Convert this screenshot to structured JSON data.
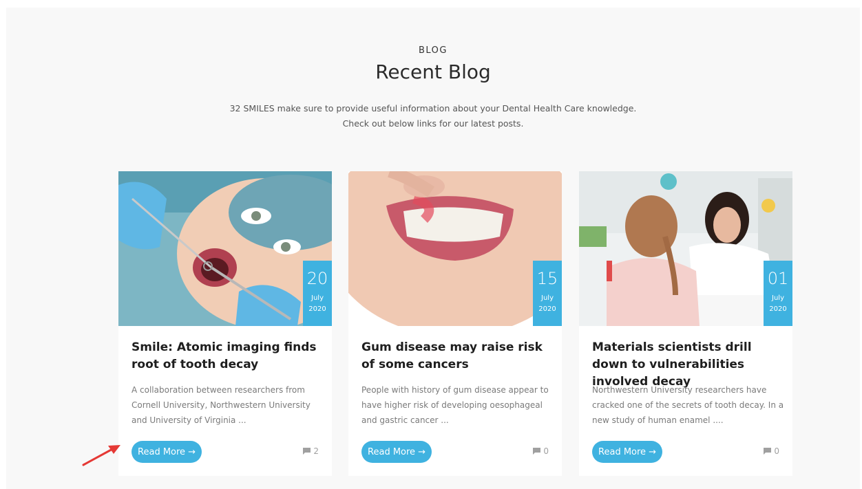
{
  "section": {
    "eyebrow": "BLOG",
    "title": "Recent Blog",
    "description_line1": "32 SMILES make sure to provide useful information about your Dental Health Care knowledge.",
    "description_line2": "Check out below links for our latest posts."
  },
  "posts": [
    {
      "day": "20",
      "month": "July",
      "year": "2020",
      "title": "Smile: Atomic imaging finds root of tooth decay",
      "excerpt": "A collaboration between researchers from Cornell University, Northwestern University and University of Virginia ...",
      "button_label": "Read More",
      "comments": "2"
    },
    {
      "day": "15",
      "month": "July",
      "year": "2020",
      "title": "Gum disease may raise risk of some cancers",
      "excerpt": "People with history of gum disease appear to have higher risk of developing oesophageal and gastric cancer ...",
      "button_label": "Read More",
      "comments": "0"
    },
    {
      "day": "01",
      "month": "July",
      "year": "2020",
      "title": "Materials scientists drill down to vulnerabilities involved decay",
      "excerpt": "Northwestern University researchers have cracked one of the secrets of tooth decay. In a new study of human enamel ....",
      "button_label": "Read More",
      "comments": "0"
    }
  ],
  "icons": {
    "button_arrow": "arrow-right-icon",
    "comment": "comment-icon",
    "cursor": "mouse-cursor-icon",
    "annotation": "red-arrow-annotation"
  },
  "colors": {
    "accent": "#3fb2e0",
    "annotation": "#e53935",
    "section_bg": "#f8f8f8"
  }
}
